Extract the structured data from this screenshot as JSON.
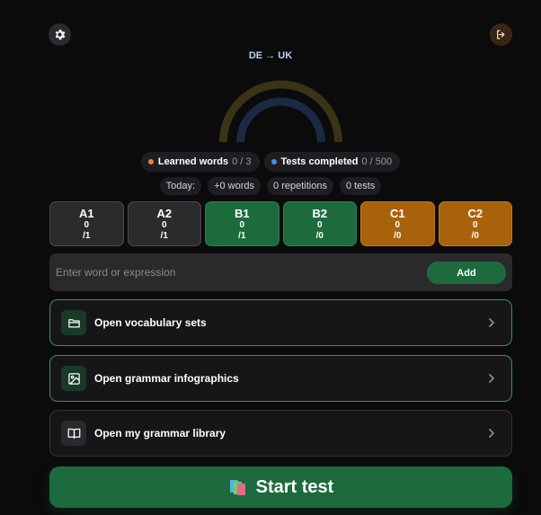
{
  "header": {
    "settings_icon": "gear-icon",
    "logout_icon": "logout-icon",
    "language_pair": "DE → UK"
  },
  "progress": {
    "learned_fraction": 0,
    "tests_fraction": 0,
    "colors": {
      "outer_arc": "#3a3315",
      "inner_arc": "#1b2a44"
    }
  },
  "stats": {
    "learned": {
      "label": "Learned words",
      "count": "0 / 3",
      "dot_color": "#e8823a"
    },
    "tests": {
      "label": "Tests completed",
      "count": "0 / 500",
      "dot_color": "#4a8fe7"
    }
  },
  "today": {
    "label": "Today:",
    "words": "+0 words",
    "repetitions": "0 repetitions",
    "tests": "0 tests"
  },
  "levels": [
    {
      "code": "A1",
      "learned": "0",
      "total": "/1",
      "color": "#2b2b2e"
    },
    {
      "code": "A2",
      "learned": "0",
      "total": "/1",
      "color": "#2b2b2e"
    },
    {
      "code": "B1",
      "learned": "0",
      "total": "/1",
      "color": "#1d6b3c"
    },
    {
      "code": "B2",
      "learned": "0",
      "total": "/0",
      "color": "#1d6b3c"
    },
    {
      "code": "C1",
      "learned": "0",
      "total": "/0",
      "color": "#a8620c"
    },
    {
      "code": "C2",
      "learned": "0",
      "total": "/0",
      "color": "#a8620c"
    }
  ],
  "add_word": {
    "placeholder": "Enter word or expression",
    "value": "",
    "button_label": "Add"
  },
  "menu": {
    "vocabulary": {
      "label": "Open vocabulary sets",
      "icon": "folder-icon"
    },
    "infographics": {
      "label": "Open grammar infographics",
      "icon": "image-icon"
    },
    "library": {
      "label": "Open my grammar library",
      "icon": "book-icon"
    }
  },
  "start_test": {
    "label": "Start test",
    "icon": "books-icon"
  },
  "accent_color": "#1d6b3c"
}
